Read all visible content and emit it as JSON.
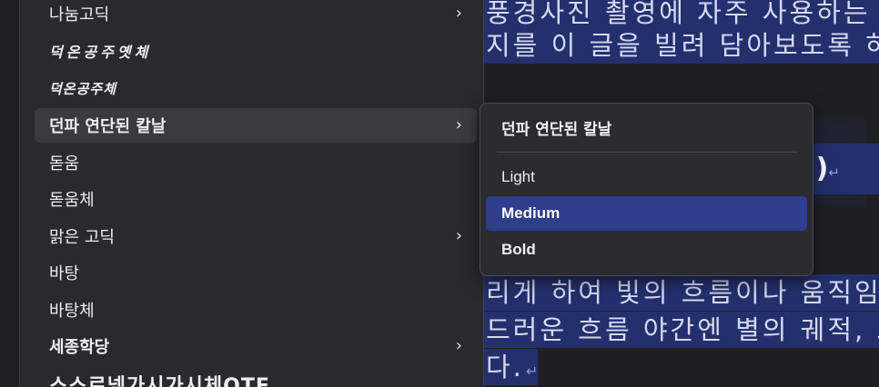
{
  "document": {
    "lines": [
      {
        "text": "풍경사진 촬영에 자주 사용하는 기",
        "selected": true
      },
      {
        "text": "지를 이 글을 빌려 담아보도록 하",
        "selected": true
      },
      {
        "text": "리게 하여 빛의 흐름이나 움직임을",
        "selected": true
      },
      {
        "text": "드러운 흐름 야간엔 별의 궤적, 모",
        "selected": true
      },
      {
        "text": "다.",
        "selected": true
      }
    ],
    "fragment": "!)",
    "paragraph_mark": "↵"
  },
  "font_menu": {
    "items": [
      {
        "label": "나눔고딕",
        "has_submenu": true
      },
      {
        "label": "덕온공주옛체",
        "has_submenu": false
      },
      {
        "label": "덕온공주체",
        "has_submenu": false
      },
      {
        "label": "던파 연단된 칼날",
        "has_submenu": true,
        "active": true
      },
      {
        "label": "돋움",
        "has_submenu": false
      },
      {
        "label": "돋움체",
        "has_submenu": false
      },
      {
        "label": "맑은 고딕",
        "has_submenu": true
      },
      {
        "label": "바탕",
        "has_submenu": false
      },
      {
        "label": "바탕체",
        "has_submenu": false
      },
      {
        "label": "세종학당",
        "has_submenu": true
      },
      {
        "label": "스스로넴가시가시체OTF",
        "has_submenu": false
      }
    ],
    "chevron": "›"
  },
  "submenu": {
    "title": "던파 연단된 칼날",
    "items": [
      {
        "label": "Light",
        "selected": false
      },
      {
        "label": "Medium",
        "selected": true
      },
      {
        "label": "Bold",
        "selected": false
      }
    ]
  },
  "colors": {
    "menu_bg": "#2a2a2e",
    "highlight": "#2e3d8c",
    "selection": "#24306e"
  }
}
